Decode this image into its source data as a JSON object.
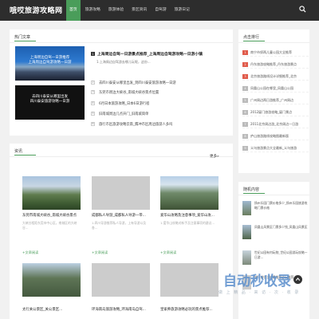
{
  "site": {
    "logo": "哦哎旅游攻略网"
  },
  "nav": [
    {
      "label": "首页",
      "active": true
    },
    {
      "label": "旅游攻略"
    },
    {
      "label": "旅游体验"
    },
    {
      "label": "景区资讯"
    },
    {
      "label": "自驾游"
    },
    {
      "label": "旅游日记"
    }
  ],
  "hot": {
    "title": "热门文章",
    "thumb1_caption": "上海周边自驾一日游推荐\n上海周边自驾游攻略一日游",
    "thumb2_caption": "去四川泰安从哪里出发\n四川泰安旅游攻略一日游",
    "featured": {
      "num": "1",
      "title": "上海周边自驾一日游景点推荐_上海周边自驾游攻略一日游小镇",
      "desc": "1.上海周边自驾游去哪儿玩呢，这份..."
    },
    "list": [
      {
        "num": "2",
        "text": "去四川泰安从哪里出发_到四川泰安旅游攻略一日游"
      },
      {
        "num": "3",
        "text": "东莞市周边大峡谷_南城大峡谷景点位置"
      },
      {
        "num": "4",
        "text": "6月日本旅游攻略_日本6日游行程"
      },
      {
        "num": "5",
        "text": "旧南城周边几点开门_旧南城简单"
      },
      {
        "num": "6",
        "text": "旅行市区旅游攻略云南_腾冲市区周边旅游人多吗"
      }
    ]
  },
  "rank": {
    "title": "点击排行",
    "items": [
      {
        "num": "1",
        "text": "南宁市郊两儿童公园大全推荐",
        "hot": true
      },
      {
        "num": "2",
        "text": "丹东旅游攻略推荐_丹东旅游景点",
        "hot": true
      },
      {
        "num": "3",
        "text": "北京旅游路线设计详细推荐_北京",
        "hot": true
      },
      {
        "num": "4",
        "text": "凤凰山公园在哪里_凤凰山公园",
        "hot": false
      },
      {
        "num": "5",
        "text": "广州周边两日游推荐_广州周边",
        "hot": false
      },
      {
        "num": "6",
        "text": "2012厦门旅游攻略_厦门景点",
        "hot": false
      },
      {
        "num": "7",
        "text": "2011北京周边游_北京周边一日游",
        "hot": false
      },
      {
        "num": "8",
        "text": "庐山旅游路线攻略图最新版",
        "hot": false
      },
      {
        "num": "9",
        "text": "义乌旅游景点大全最新_义乌旅游",
        "hot": false
      }
    ]
  },
  "news": {
    "title": "资讯",
    "more": "更多»",
    "cards": [
      {
        "title": "东莞市南城大峡谷_南城大峡谷景点",
        "desc": "大峡谷相距东莞市中心区，南城区的大峡谷...",
        "link": "+文章阅读"
      },
      {
        "title": "成都私人导游_成都私人导游一带...",
        "desc": "1.四川导游推荐私人导游，上有导游以及各...",
        "link": "+文章阅读"
      },
      {
        "title": "爱华山攻略及注意事项_爱华山攻...",
        "desc": "1.爱华山攻略对新手及注意事项的建议...",
        "link": "+文章阅读"
      }
    ],
    "bottom_captions": [
      "太行关公景区_关公景区...",
      "环海南岛旅游攻略_环海南岛自驾...",
      "皇家养旅游攻略必玩的景点推荐..."
    ]
  },
  "random": {
    "title": "随机内容",
    "items": [
      {
        "text": "扬州乐园门票价格多少_扬州乐园旅游攻略门票价格"
      },
      {
        "text": "凤凰山风景区门票多少钱_凤凰山风景区"
      },
      {
        "text": "世纪公园有何玩物_世纪公园游玩攻略一日游..."
      },
      {
        "text": "城下前往当地最推荐必玩推荐..."
      }
    ]
  },
  "watermark": {
    "text": "自动秒收录",
    "sub": "做 上 精 品 · 来 访 · 次 · 收 录"
  },
  "colors": {
    "accent": "#4a9d5a",
    "topbar": "#2d2d2d",
    "hot": "#e05b4b"
  }
}
